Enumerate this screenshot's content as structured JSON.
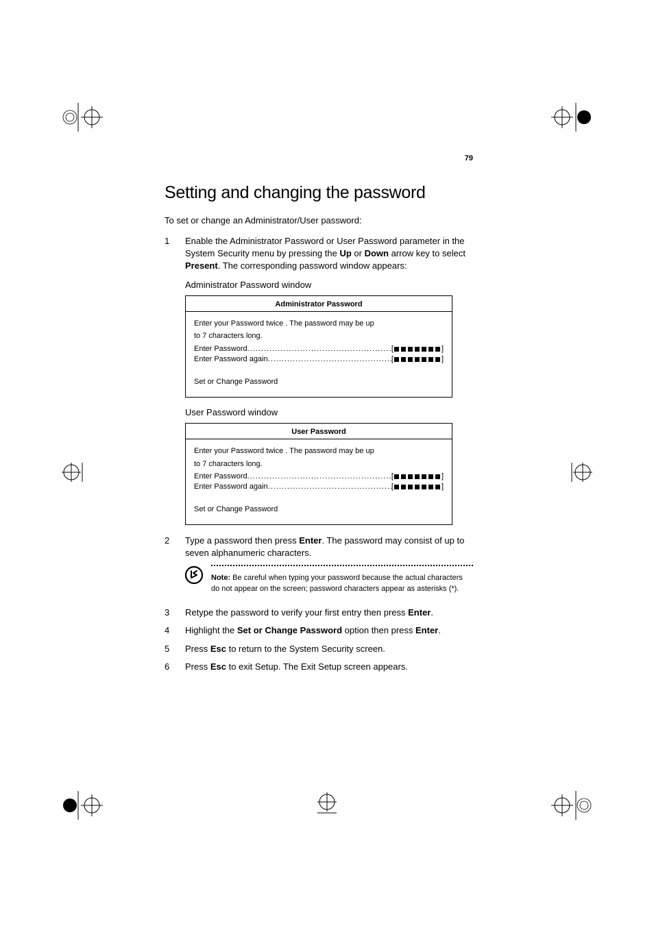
{
  "pageNumber": "79",
  "heading": "Setting and changing the password",
  "intro": "To set or change an Administrator/User password:",
  "steps": {
    "s1": {
      "num": "1",
      "text_a": "Enable the Administrator Password or User Password parameter in the System Security menu by pressing the ",
      "bold_up": "Up",
      "text_b": " or ",
      "bold_down": "Down",
      "text_c": " arrow key to select ",
      "bold_present": "Present",
      "text_d": ".  The corresponding password window appears:"
    },
    "adminCaption": "Administrator Password window",
    "userCaption": "User Password window",
    "s2": {
      "num": "2",
      "text_a": "Type a password then press ",
      "bold_enter": "Enter",
      "text_b": ".  The password may consist of up to seven alphanumeric characters."
    },
    "s3": {
      "num": "3",
      "text_a": "Retype the password to verify your first entry then press ",
      "bold_enter": "Enter",
      "text_b": "."
    },
    "s4": {
      "num": "4",
      "text_a": "Highlight the ",
      "bold_opt": "Set or Change Password",
      "text_b": " option then press ",
      "bold_enter": "Enter",
      "text_c": "."
    },
    "s5": {
      "num": "5",
      "text_a": "Press ",
      "bold_esc": "Esc",
      "text_b": " to return to the System Security screen."
    },
    "s6": {
      "num": "6",
      "text_a": "Press ",
      "bold_esc": "Esc",
      "text_b": " to exit Setup.  The Exit Setup screen appears."
    }
  },
  "note": {
    "label": "Note:",
    "text": " Be careful when typing your password because the actual characters do not appear on the screen; password characters appear as asterisks (*)."
  },
  "dialogAdmin": {
    "title": "Administrator Password",
    "instr1": "Enter your Password twice . The password may be up",
    "instr2": "to 7 characters long.",
    "line1": "Enter Password",
    "line2": "Enter Password again",
    "setChange": "Set or Change Password"
  },
  "dialogUser": {
    "title": "User Password",
    "instr1": "Enter your Password twice . The password may be up",
    "instr2": "to 7 characters long.",
    "line1": "Enter Password",
    "line2": "Enter Password again",
    "setChange": "Set or Change Password"
  },
  "dots": "..............................................................."
}
